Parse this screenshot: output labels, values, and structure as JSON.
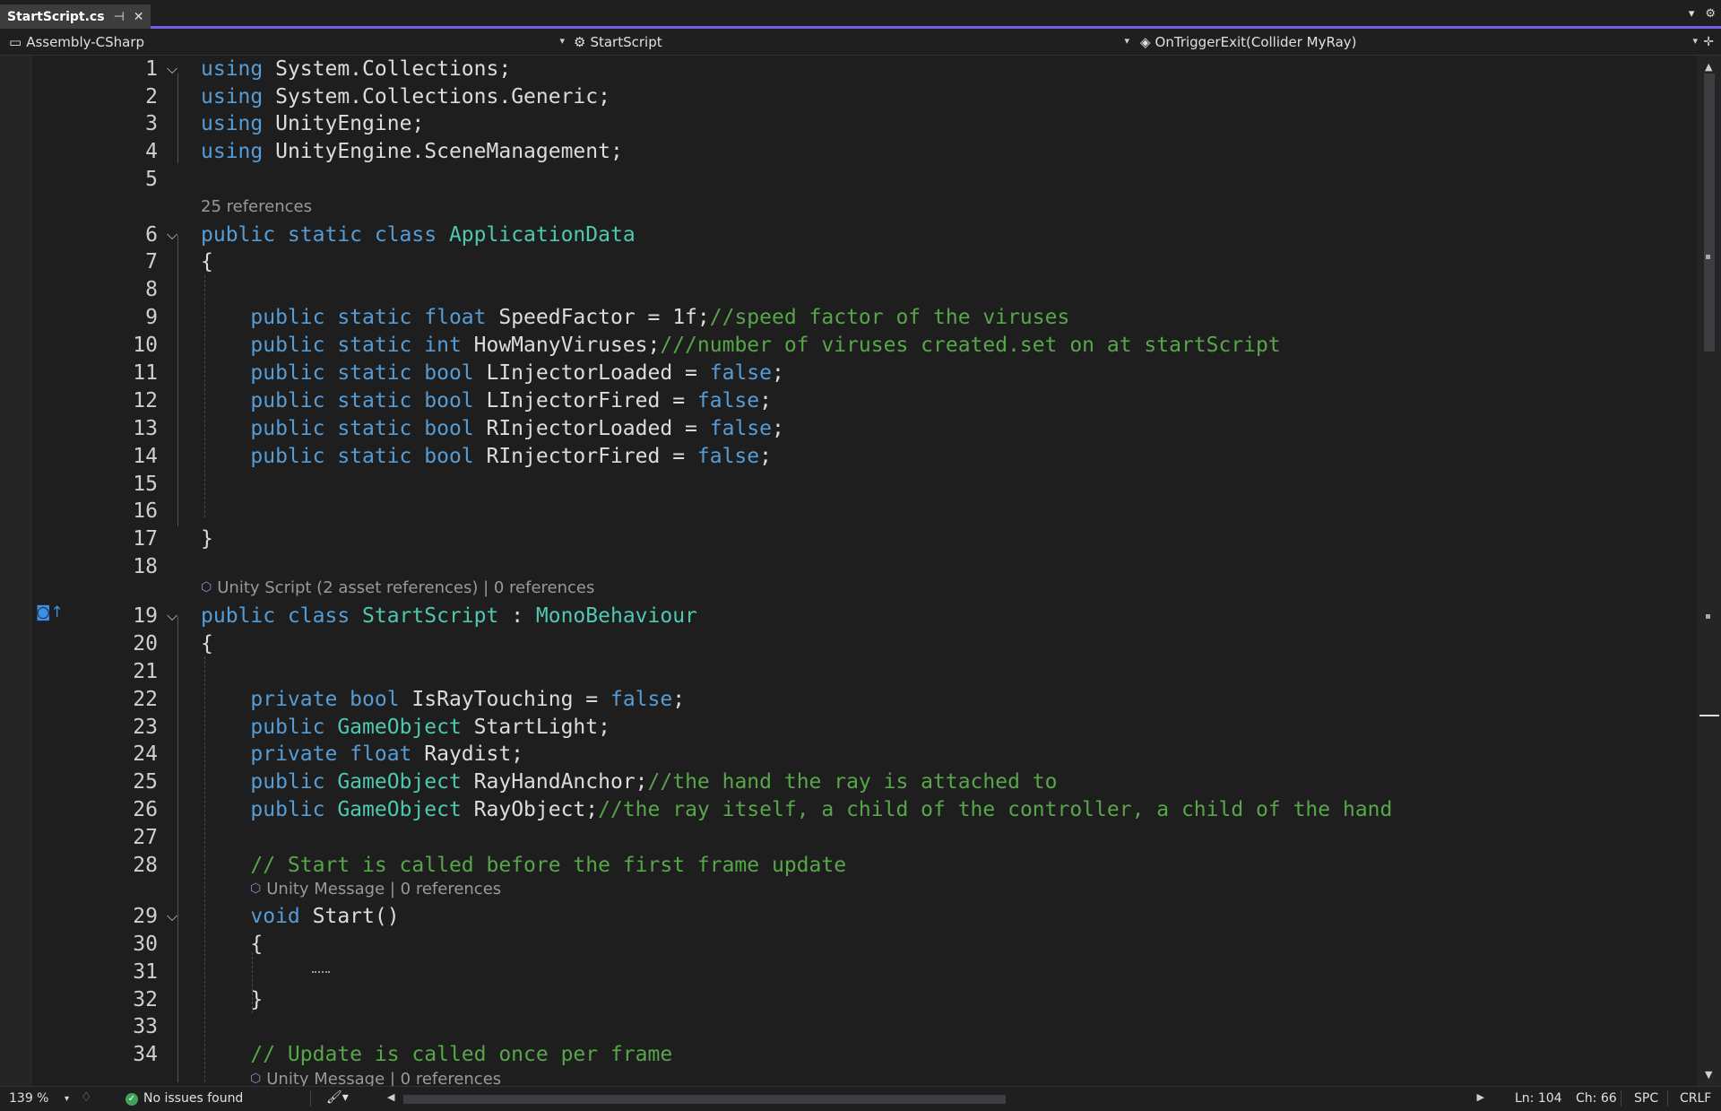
{
  "tab": {
    "title": "StartScript.cs",
    "pin_glyph": "⊣",
    "close_glyph": "✕"
  },
  "navbar": {
    "project": "Assembly-CSharp",
    "class": "StartScript",
    "member": "OnTriggerExit(Collider MyRay)"
  },
  "lenses": {
    "app_data_refs": "25 references",
    "start_script_refs": "Unity Script (2 asset references) | 0 references",
    "start_msg_refs": "Unity Message | 0 references",
    "update_msg_refs": "Unity Message | 0 references"
  },
  "code_lines": [
    {
      "n": "1",
      "tokens": [
        [
          "kw",
          "using"
        ],
        [
          "p",
          " System.Collections;"
        ]
      ]
    },
    {
      "n": "2",
      "tokens": [
        [
          "kw",
          "using"
        ],
        [
          "p",
          " System.Collections.Generic;"
        ]
      ]
    },
    {
      "n": "3",
      "tokens": [
        [
          "kw",
          "using"
        ],
        [
          "p",
          " UnityEngine;"
        ]
      ]
    },
    {
      "n": "4",
      "tokens": [
        [
          "kw",
          "using"
        ],
        [
          "p",
          " UnityEngine.SceneManagement;"
        ]
      ]
    },
    {
      "n": "5",
      "tokens": []
    },
    {
      "n": "6",
      "tokens": [
        [
          "kw",
          "public static class "
        ],
        [
          "ty",
          "ApplicationData"
        ]
      ]
    },
    {
      "n": "7",
      "tokens": [
        [
          "p",
          "{"
        ]
      ]
    },
    {
      "n": "8",
      "tokens": []
    },
    {
      "n": "9",
      "tokens": [
        [
          "p",
          "    "
        ],
        [
          "kw",
          "public static float"
        ],
        [
          "p",
          " SpeedFactor = 1f;"
        ],
        [
          "cm",
          "//speed factor of the viruses"
        ]
      ]
    },
    {
      "n": "10",
      "tokens": [
        [
          "p",
          "    "
        ],
        [
          "kw",
          "public static int"
        ],
        [
          "p",
          " HowManyViruses;"
        ],
        [
          "cm",
          "///number of viruses created.set on at startScript"
        ]
      ]
    },
    {
      "n": "11",
      "tokens": [
        [
          "p",
          "    "
        ],
        [
          "kw",
          "public static bool"
        ],
        [
          "p",
          " LInjectorLoaded = "
        ],
        [
          "kw",
          "false"
        ],
        [
          "p",
          ";"
        ]
      ]
    },
    {
      "n": "12",
      "tokens": [
        [
          "p",
          "    "
        ],
        [
          "kw",
          "public static bool"
        ],
        [
          "p",
          " LInjectorFired = "
        ],
        [
          "kw",
          "false"
        ],
        [
          "p",
          ";"
        ]
      ]
    },
    {
      "n": "13",
      "tokens": [
        [
          "p",
          "    "
        ],
        [
          "kw",
          "public static bool"
        ],
        [
          "p",
          " RInjectorLoaded = "
        ],
        [
          "kw",
          "false"
        ],
        [
          "p",
          ";"
        ]
      ]
    },
    {
      "n": "14",
      "tokens": [
        [
          "p",
          "    "
        ],
        [
          "kw",
          "public static bool"
        ],
        [
          "p",
          " RInjectorFired = "
        ],
        [
          "kw",
          "false"
        ],
        [
          "p",
          ";"
        ]
      ]
    },
    {
      "n": "15",
      "tokens": []
    },
    {
      "n": "16",
      "tokens": []
    },
    {
      "n": "17",
      "tokens": [
        [
          "p",
          "}"
        ]
      ]
    },
    {
      "n": "18",
      "tokens": []
    },
    {
      "n": "19",
      "tokens": [
        [
          "kw",
          "public class "
        ],
        [
          "ty",
          "StartScript"
        ],
        [
          "p",
          " : "
        ],
        [
          "ty",
          "MonoBehaviour"
        ]
      ]
    },
    {
      "n": "20",
      "tokens": [
        [
          "p",
          "{"
        ]
      ]
    },
    {
      "n": "21",
      "tokens": []
    },
    {
      "n": "22",
      "tokens": [
        [
          "p",
          "    "
        ],
        [
          "kw",
          "private bool"
        ],
        [
          "p",
          " IsRayTouching = "
        ],
        [
          "kw",
          "false"
        ],
        [
          "p",
          ";"
        ]
      ]
    },
    {
      "n": "23",
      "tokens": [
        [
          "p",
          "    "
        ],
        [
          "kw",
          "public "
        ],
        [
          "ty",
          "GameObject"
        ],
        [
          "p",
          " StartLight;"
        ]
      ]
    },
    {
      "n": "24",
      "tokens": [
        [
          "p",
          "    "
        ],
        [
          "kw",
          "private float"
        ],
        [
          "p",
          " Raydist;"
        ]
      ]
    },
    {
      "n": "25",
      "tokens": [
        [
          "p",
          "    "
        ],
        [
          "kw",
          "public "
        ],
        [
          "ty",
          "GameObject"
        ],
        [
          "p",
          " RayHandAnchor;"
        ],
        [
          "cm",
          "//the hand the ray is attached to"
        ]
      ]
    },
    {
      "n": "26",
      "tokens": [
        [
          "p",
          "    "
        ],
        [
          "kw",
          "public "
        ],
        [
          "ty",
          "GameObject"
        ],
        [
          "p",
          " RayObject;"
        ],
        [
          "cm",
          "//the ray itself, a child of the controller, a child of the hand"
        ]
      ]
    },
    {
      "n": "27",
      "tokens": []
    },
    {
      "n": "28",
      "tokens": [
        [
          "p",
          "    "
        ],
        [
          "cm",
          "// Start is called before the first frame update"
        ]
      ]
    },
    {
      "n": "29",
      "tokens": [
        [
          "p",
          "    "
        ],
        [
          "kw",
          "void"
        ],
        [
          "p",
          " Start()"
        ]
      ]
    },
    {
      "n": "30",
      "tokens": [
        [
          "p",
          "    {"
        ]
      ]
    },
    {
      "n": "31",
      "tokens": []
    },
    {
      "n": "32",
      "tokens": [
        [
          "p",
          "    }"
        ]
      ]
    },
    {
      "n": "33",
      "tokens": []
    },
    {
      "n": "34",
      "tokens": [
        [
          "p",
          "    "
        ],
        [
          "cm",
          "// Update is called once per frame"
        ]
      ]
    }
  ],
  "status": {
    "zoom": "139 %",
    "issues": "No issues found",
    "line": "Ln: 104",
    "char": "Ch: 66",
    "spacing": "SPC",
    "line_ending": "CRLF"
  },
  "colors": {
    "keyword": "#569cd6",
    "type": "#4ec9b0",
    "comment": "#57a64a",
    "accent": "#7160e8"
  }
}
